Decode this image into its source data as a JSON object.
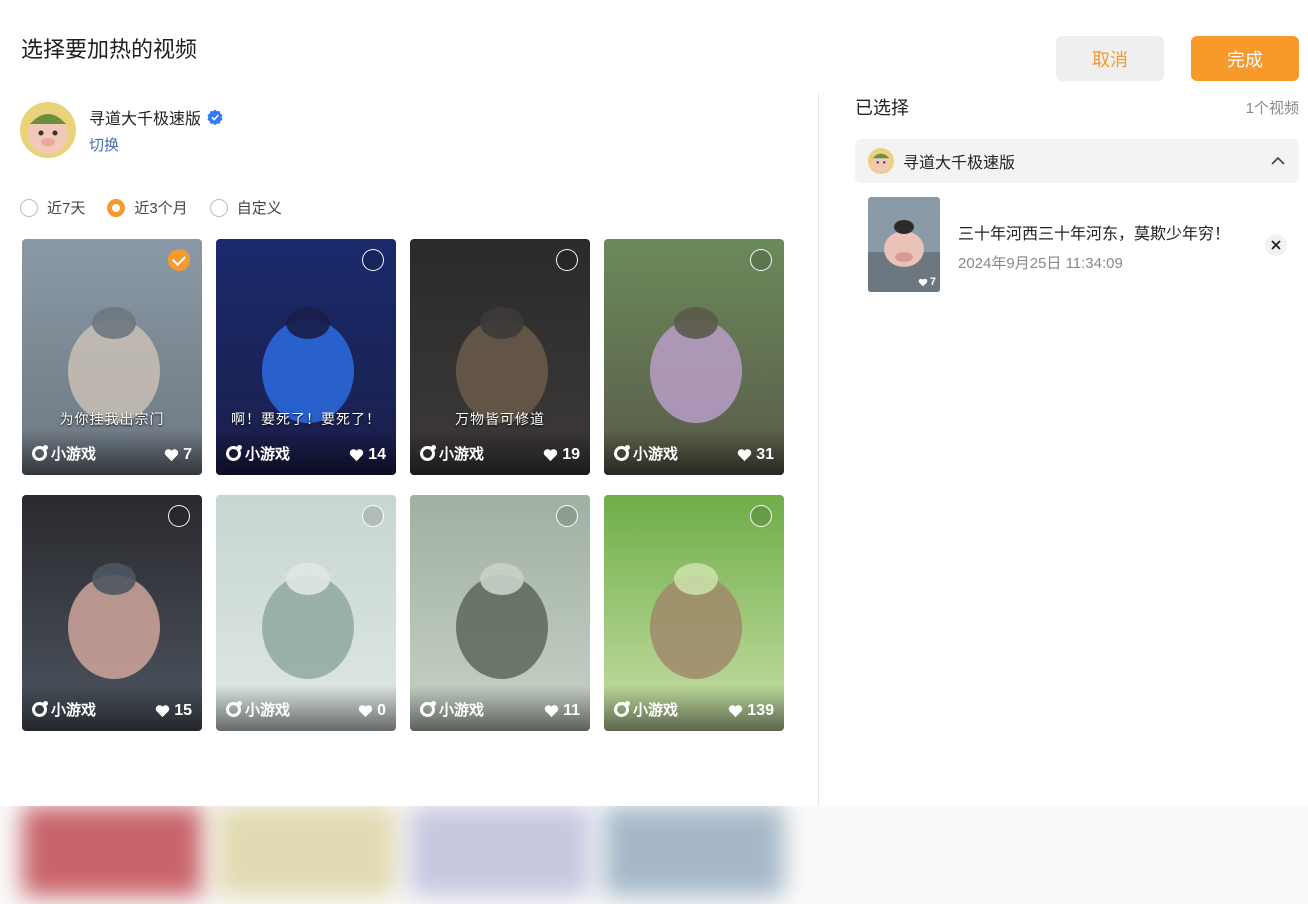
{
  "dialog": {
    "title": "选择要加热的视频"
  },
  "account": {
    "name": "寻道大千极速版",
    "switch_label": "切换"
  },
  "range": {
    "options": [
      {
        "label": "近7天",
        "checked": false
      },
      {
        "label": "近3个月",
        "checked": true
      },
      {
        "label": "自定义",
        "checked": false
      }
    ]
  },
  "videos": [
    {
      "caption": "为你挂我出宗门",
      "tag": "小游戏",
      "likes": "7",
      "selected": true,
      "palette": [
        "#8a9aa6",
        "#c9c0b6",
        "#6d7780"
      ]
    },
    {
      "caption": "啊！要死了！要死了！",
      "tag": "小游戏",
      "likes": "14",
      "selected": false,
      "palette": [
        "#1a2a6b",
        "#2a6be0",
        "#1b1e4a"
      ]
    },
    {
      "caption": "万物皆可修道",
      "tag": "小游戏",
      "likes": "19",
      "selected": false,
      "palette": [
        "#2b2b2b",
        "#6b5a4a",
        "#3d3a38"
      ]
    },
    {
      "caption": "",
      "tag": "小游戏",
      "likes": "31",
      "selected": false,
      "palette": [
        "#6b8a5a",
        "#b89ec8",
        "#5a5a4a"
      ]
    },
    {
      "caption": "",
      "tag": "小游戏",
      "likes": "15",
      "selected": false,
      "palette": [
        "#2a2a2e",
        "#cfa49a",
        "#4d5560"
      ]
    },
    {
      "caption": "",
      "tag": "小游戏",
      "likes": "0",
      "selected": false,
      "palette": [
        "#c7d6d2",
        "#8fa8a2",
        "#dfe7e4"
      ]
    },
    {
      "caption": "",
      "tag": "小游戏",
      "likes": "11",
      "selected": false,
      "palette": [
        "#9fb0a2",
        "#5d6659",
        "#c9d2c8"
      ]
    },
    {
      "caption": "",
      "tag": "小游戏",
      "likes": "139",
      "selected": false,
      "palette": [
        "#6fae48",
        "#a08a6a",
        "#c9dfa8"
      ]
    }
  ],
  "ghost_row": [
    {
      "palette": "#b8323a"
    },
    {
      "palette": "#d9d09a"
    },
    {
      "palette": "#b6b6d8"
    },
    {
      "palette": "#8aa3b8"
    }
  ],
  "selected_panel": {
    "title": "已选择",
    "count": "1个视频",
    "group_name": "寻道大千极速版",
    "item": {
      "title": "三十年河西三十年河东，莫欺少年穷！",
      "date": "2024年9月25日 11:34:09",
      "likes": "7"
    }
  },
  "buttons": {
    "cancel": "取消",
    "done": "完成"
  },
  "colors": {
    "accent": "#f79a2b",
    "link": "#4a6da7",
    "verified": "#2f7bf6"
  }
}
